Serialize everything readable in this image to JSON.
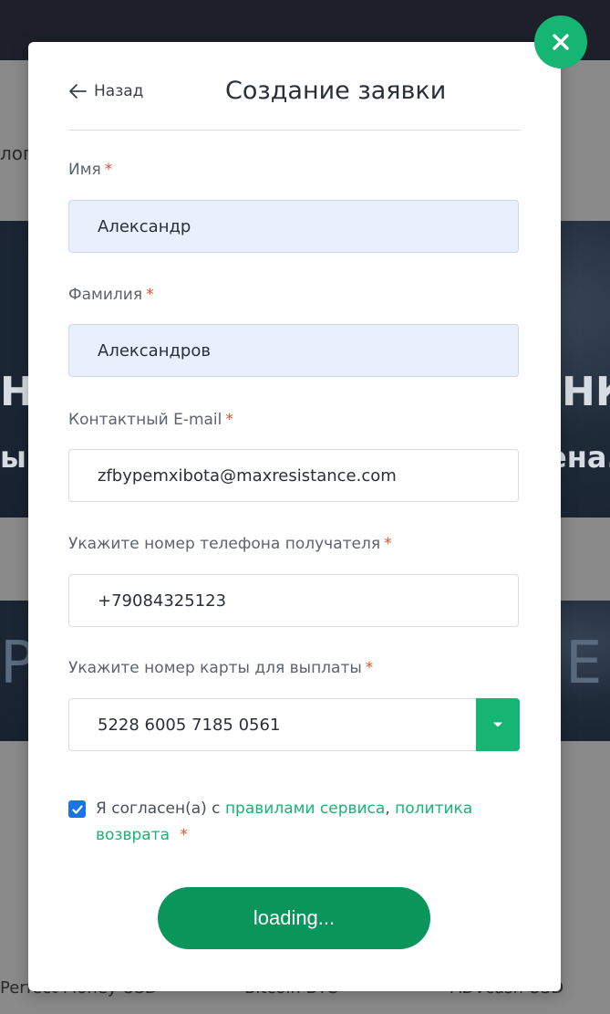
{
  "background": {
    "left_fragment": "лог",
    "big_left": "Н",
    "big_right": "НК",
    "line_left": "ы(",
    "line_right": "ена.",
    "banner_left": "Р",
    "banner_right": "Е",
    "bottom_labels": [
      "Perfect Money USD",
      "Bitcoin BTC",
      "ADVcash USD"
    ]
  },
  "modal": {
    "back_label": "Назад",
    "title": "Создание заявки",
    "required_mark": "*",
    "fields": {
      "first_name": {
        "label": "Имя",
        "value": "Александр"
      },
      "last_name": {
        "label": "Фамилия",
        "value": "Александров"
      },
      "email": {
        "label": "Контактный E-mail",
        "value": "zfbypemxibota@maxresistance.com"
      },
      "phone": {
        "label": "Укажите номер телефона получателя",
        "value": "+79084325123"
      },
      "card": {
        "label": "Укажите номер карты для выплаты",
        "value": "5228 6005 7185 0561"
      }
    },
    "agreement": {
      "checked": true,
      "prefix": "Я согласен(а) с ",
      "rules_link": "правилами сервиса",
      "separator": ", ",
      "refund_link": "политика возврата"
    },
    "submit_label": "loading..."
  },
  "colors": {
    "accent": "#16b574",
    "submit": "#0a955a",
    "required": "#e5502d",
    "autofill": "#e8f0fe",
    "checkbox": "#1a73e8"
  },
  "icons": {
    "close": "close-icon",
    "back": "arrow-left-icon",
    "dropdown": "caret-down-icon",
    "check": "check-icon"
  }
}
